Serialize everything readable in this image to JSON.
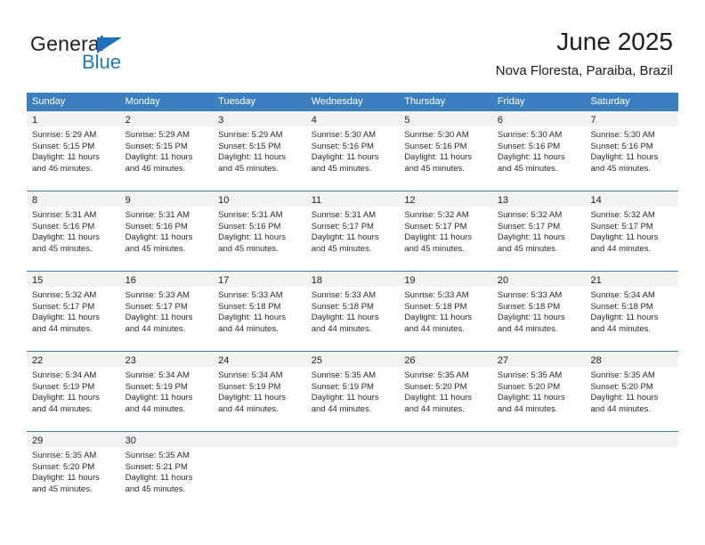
{
  "brand": {
    "name_primary": "General",
    "name_secondary": "Blue",
    "triangle_icon": "brand-triangle-icon",
    "primary_color": "#231f20",
    "accent_color": "#1f7ac4"
  },
  "header": {
    "title": "June 2025",
    "subtitle": "Nova Floresta, Paraiba, Brazil"
  },
  "theme": {
    "header_bg": "#3c7fc1",
    "header_text": "#ffffff",
    "daynum_band_bg": "#f2f2f2",
    "cell_bg": "#ffffff",
    "text": "#222222"
  },
  "weekdays": [
    "Sunday",
    "Monday",
    "Tuesday",
    "Wednesday",
    "Thursday",
    "Friday",
    "Saturday"
  ],
  "weeks": [
    [
      {
        "day": "1",
        "sunrise": "Sunrise: 5:29 AM",
        "sunset": "Sunset: 5:15 PM",
        "daylight_line1": "Daylight: 11 hours",
        "daylight_line2": "and 46 minutes."
      },
      {
        "day": "2",
        "sunrise": "Sunrise: 5:29 AM",
        "sunset": "Sunset: 5:15 PM",
        "daylight_line1": "Daylight: 11 hours",
        "daylight_line2": "and 46 minutes."
      },
      {
        "day": "3",
        "sunrise": "Sunrise: 5:29 AM",
        "sunset": "Sunset: 5:15 PM",
        "daylight_line1": "Daylight: 11 hours",
        "daylight_line2": "and 45 minutes."
      },
      {
        "day": "4",
        "sunrise": "Sunrise: 5:30 AM",
        "sunset": "Sunset: 5:16 PM",
        "daylight_line1": "Daylight: 11 hours",
        "daylight_line2": "and 45 minutes."
      },
      {
        "day": "5",
        "sunrise": "Sunrise: 5:30 AM",
        "sunset": "Sunset: 5:16 PM",
        "daylight_line1": "Daylight: 11 hours",
        "daylight_line2": "and 45 minutes."
      },
      {
        "day": "6",
        "sunrise": "Sunrise: 5:30 AM",
        "sunset": "Sunset: 5:16 PM",
        "daylight_line1": "Daylight: 11 hours",
        "daylight_line2": "and 45 minutes."
      },
      {
        "day": "7",
        "sunrise": "Sunrise: 5:30 AM",
        "sunset": "Sunset: 5:16 PM",
        "daylight_line1": "Daylight: 11 hours",
        "daylight_line2": "and 45 minutes."
      }
    ],
    [
      {
        "day": "8",
        "sunrise": "Sunrise: 5:31 AM",
        "sunset": "Sunset: 5:16 PM",
        "daylight_line1": "Daylight: 11 hours",
        "daylight_line2": "and 45 minutes."
      },
      {
        "day": "9",
        "sunrise": "Sunrise: 5:31 AM",
        "sunset": "Sunset: 5:16 PM",
        "daylight_line1": "Daylight: 11 hours",
        "daylight_line2": "and 45 minutes."
      },
      {
        "day": "10",
        "sunrise": "Sunrise: 5:31 AM",
        "sunset": "Sunset: 5:16 PM",
        "daylight_line1": "Daylight: 11 hours",
        "daylight_line2": "and 45 minutes."
      },
      {
        "day": "11",
        "sunrise": "Sunrise: 5:31 AM",
        "sunset": "Sunset: 5:17 PM",
        "daylight_line1": "Daylight: 11 hours",
        "daylight_line2": "and 45 minutes."
      },
      {
        "day": "12",
        "sunrise": "Sunrise: 5:32 AM",
        "sunset": "Sunset: 5:17 PM",
        "daylight_line1": "Daylight: 11 hours",
        "daylight_line2": "and 45 minutes."
      },
      {
        "day": "13",
        "sunrise": "Sunrise: 5:32 AM",
        "sunset": "Sunset: 5:17 PM",
        "daylight_line1": "Daylight: 11 hours",
        "daylight_line2": "and 45 minutes."
      },
      {
        "day": "14",
        "sunrise": "Sunrise: 5:32 AM",
        "sunset": "Sunset: 5:17 PM",
        "daylight_line1": "Daylight: 11 hours",
        "daylight_line2": "and 44 minutes."
      }
    ],
    [
      {
        "day": "15",
        "sunrise": "Sunrise: 5:32 AM",
        "sunset": "Sunset: 5:17 PM",
        "daylight_line1": "Daylight: 11 hours",
        "daylight_line2": "and 44 minutes."
      },
      {
        "day": "16",
        "sunrise": "Sunrise: 5:33 AM",
        "sunset": "Sunset: 5:17 PM",
        "daylight_line1": "Daylight: 11 hours",
        "daylight_line2": "and 44 minutes."
      },
      {
        "day": "17",
        "sunrise": "Sunrise: 5:33 AM",
        "sunset": "Sunset: 5:18 PM",
        "daylight_line1": "Daylight: 11 hours",
        "daylight_line2": "and 44 minutes."
      },
      {
        "day": "18",
        "sunrise": "Sunrise: 5:33 AM",
        "sunset": "Sunset: 5:18 PM",
        "daylight_line1": "Daylight: 11 hours",
        "daylight_line2": "and 44 minutes."
      },
      {
        "day": "19",
        "sunrise": "Sunrise: 5:33 AM",
        "sunset": "Sunset: 5:18 PM",
        "daylight_line1": "Daylight: 11 hours",
        "daylight_line2": "and 44 minutes."
      },
      {
        "day": "20",
        "sunrise": "Sunrise: 5:33 AM",
        "sunset": "Sunset: 5:18 PM",
        "daylight_line1": "Daylight: 11 hours",
        "daylight_line2": "and 44 minutes."
      },
      {
        "day": "21",
        "sunrise": "Sunrise: 5:34 AM",
        "sunset": "Sunset: 5:18 PM",
        "daylight_line1": "Daylight: 11 hours",
        "daylight_line2": "and 44 minutes."
      }
    ],
    [
      {
        "day": "22",
        "sunrise": "Sunrise: 5:34 AM",
        "sunset": "Sunset: 5:19 PM",
        "daylight_line1": "Daylight: 11 hours",
        "daylight_line2": "and 44 minutes."
      },
      {
        "day": "23",
        "sunrise": "Sunrise: 5:34 AM",
        "sunset": "Sunset: 5:19 PM",
        "daylight_line1": "Daylight: 11 hours",
        "daylight_line2": "and 44 minutes."
      },
      {
        "day": "24",
        "sunrise": "Sunrise: 5:34 AM",
        "sunset": "Sunset: 5:19 PM",
        "daylight_line1": "Daylight: 11 hours",
        "daylight_line2": "and 44 minutes."
      },
      {
        "day": "25",
        "sunrise": "Sunrise: 5:35 AM",
        "sunset": "Sunset: 5:19 PM",
        "daylight_line1": "Daylight: 11 hours",
        "daylight_line2": "and 44 minutes."
      },
      {
        "day": "26",
        "sunrise": "Sunrise: 5:35 AM",
        "sunset": "Sunset: 5:20 PM",
        "daylight_line1": "Daylight: 11 hours",
        "daylight_line2": "and 44 minutes."
      },
      {
        "day": "27",
        "sunrise": "Sunrise: 5:35 AM",
        "sunset": "Sunset: 5:20 PM",
        "daylight_line1": "Daylight: 11 hours",
        "daylight_line2": "and 44 minutes."
      },
      {
        "day": "28",
        "sunrise": "Sunrise: 5:35 AM",
        "sunset": "Sunset: 5:20 PM",
        "daylight_line1": "Daylight: 11 hours",
        "daylight_line2": "and 44 minutes."
      }
    ],
    [
      {
        "day": "29",
        "sunrise": "Sunrise: 5:35 AM",
        "sunset": "Sunset: 5:20 PM",
        "daylight_line1": "Daylight: 11 hours",
        "daylight_line2": "and 45 minutes."
      },
      {
        "day": "30",
        "sunrise": "Sunrise: 5:35 AM",
        "sunset": "Sunset: 5:21 PM",
        "daylight_line1": "Daylight: 11 hours",
        "daylight_line2": "and 45 minutes."
      },
      {
        "day": "",
        "sunrise": "",
        "sunset": "",
        "daylight_line1": "",
        "daylight_line2": ""
      },
      {
        "day": "",
        "sunrise": "",
        "sunset": "",
        "daylight_line1": "",
        "daylight_line2": ""
      },
      {
        "day": "",
        "sunrise": "",
        "sunset": "",
        "daylight_line1": "",
        "daylight_line2": ""
      },
      {
        "day": "",
        "sunrise": "",
        "sunset": "",
        "daylight_line1": "",
        "daylight_line2": ""
      },
      {
        "day": "",
        "sunrise": "",
        "sunset": "",
        "daylight_line1": "",
        "daylight_line2": ""
      }
    ]
  ]
}
